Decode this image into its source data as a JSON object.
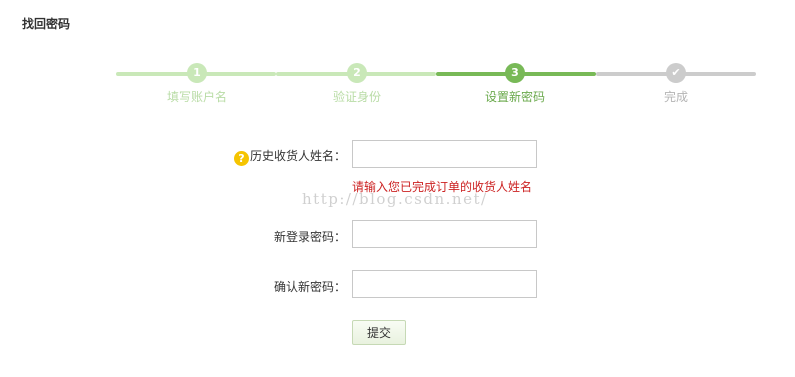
{
  "page": {
    "title": "找回密码"
  },
  "stepper": {
    "steps": [
      {
        "number": "1",
        "label": "填写账户名",
        "state": "done"
      },
      {
        "number": "2",
        "label": "验证身份",
        "state": "done"
      },
      {
        "number": "3",
        "label": "设置新密码",
        "state": "active"
      },
      {
        "number": "✔",
        "label": "完成",
        "state": "todo"
      }
    ]
  },
  "form": {
    "consignee_label": "历史收货人姓名：",
    "consignee_help_icon": "?",
    "consignee_value": "",
    "consignee_error": "请输入您已完成订单的收货人姓名",
    "new_password_label": "新登录密码：",
    "new_password_value": "",
    "confirm_password_label": "确认新密码：",
    "confirm_password_value": "",
    "submit_label": "提交"
  },
  "watermark": {
    "text": "http://blog.csdn.net/"
  },
  "colors": {
    "step_done": "#c9e8b8",
    "step_active": "#78b957",
    "step_todo": "#cccccc",
    "error": "#cc2222",
    "help_icon": "#f5c400"
  }
}
